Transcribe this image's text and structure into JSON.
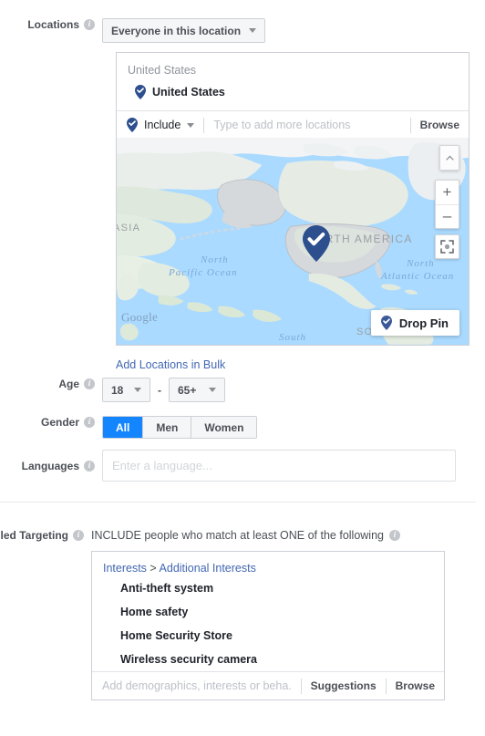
{
  "locations": {
    "label": "Locations",
    "info_icon": "info-icon",
    "scope_dropdown": {
      "value": "Everyone in this location",
      "caret_icon": "chevron-down-icon"
    },
    "box_header": "United States",
    "selected_location": {
      "name": "United States",
      "pin_icon": "location-pin-check-icon"
    },
    "include_dropdown": {
      "value": "Include",
      "pin_icon": "location-pin-check-icon",
      "caret_icon": "chevron-down-icon"
    },
    "search_placeholder": "Type to add more locations",
    "search_value": "",
    "browse_label": "Browse",
    "bulk_link": "Add Locations in Bulk"
  },
  "map": {
    "labels": {
      "north_pacific_line1": "North",
      "north_pacific_line2": "Pacific Ocean",
      "north_atlantic_line1": "North",
      "north_atlantic_line2": "Atlantic Ocean",
      "south": "South",
      "asia": "ASIA",
      "north_america": "NORTH AMERICA",
      "south_america": "SOUTH AMERICA",
      "attribution": "Google"
    },
    "controls": {
      "collapse_icon": "chevron-up-icon",
      "zoom_in_label": "+",
      "zoom_in_icon": "plus-icon",
      "zoom_out_label": "–",
      "zoom_out_icon": "minus-icon",
      "fullscreen_icon": "fullscreen-icon"
    },
    "drop_pin_button": {
      "label": "Drop Pin",
      "pin_icon": "location-pin-check-icon"
    },
    "marker_icon": "map-marker-check-icon"
  },
  "age": {
    "label": "Age",
    "min": "18",
    "max": "65+",
    "separator": "-",
    "caret_icon": "chevron-down-icon"
  },
  "gender": {
    "label": "Gender",
    "options": [
      {
        "label": "All",
        "selected": true
      },
      {
        "label": "Men",
        "selected": false
      },
      {
        "label": "Women",
        "selected": false
      }
    ]
  },
  "languages": {
    "label": "Languages",
    "placeholder": "Enter a language...",
    "value": ""
  },
  "detailed_targeting": {
    "label": "Detailed Targeting",
    "heading": "INCLUDE people who match at least ONE of the following",
    "breadcrumb": {
      "root": "Interests",
      "separator": ">",
      "child": "Additional Interests"
    },
    "items": [
      "Anti-theft system",
      "Home safety",
      "Home Security Store",
      "Wireless security camera"
    ],
    "input_placeholder": "Add demographics, interests or beha...",
    "input_value": "",
    "suggestions_label": "Suggestions",
    "browse_label": "Browse"
  },
  "colors": {
    "accent_blue": "#1385ff",
    "link_blue": "#4267b2",
    "pin_navy": "#2d4f8e",
    "border": "#ccd0d5",
    "text_dark": "#1d2129",
    "text_muted": "#4b4f56",
    "placeholder": "#bdc1c7",
    "map_water": "#aadaff"
  }
}
